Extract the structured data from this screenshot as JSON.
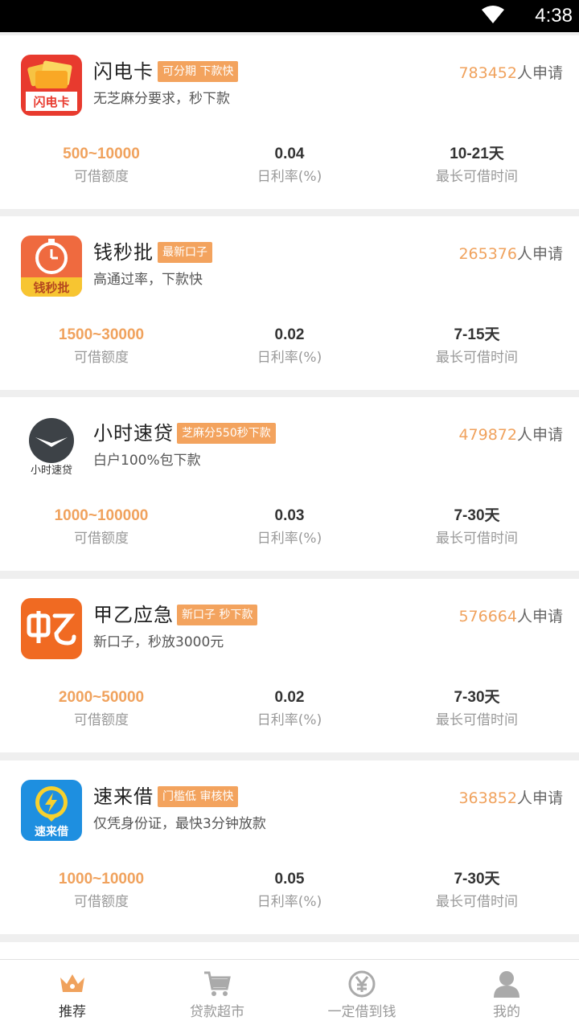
{
  "status_bar": {
    "time": "4:38"
  },
  "colors": {
    "accent": "#f0a25d",
    "tag_bg": "#f3a35e",
    "tab_active": "#f0a25d",
    "tab_inactive": "#aaaaaa"
  },
  "stat_labels": {
    "amount": "可借额度",
    "rate": "日利率(%)",
    "term": "最长可借时间"
  },
  "applicant_suffix": "人申请",
  "products": [
    {
      "name": "闪电卡",
      "tag": "可分期 下款快",
      "applicants": "783452",
      "desc": "无芝麻分要求，秒下款",
      "amount": "500~10000",
      "rate": "0.04",
      "term": "10-21天",
      "logo_text": "闪电卡",
      "icon": "credit-card-icon"
    },
    {
      "name": "钱秒批",
      "tag": "最新口子",
      "applicants": "265376",
      "desc": "高通过率，下款快",
      "amount": "1500~30000",
      "rate": "0.02",
      "term": "7-15天",
      "logo_text": "钱秒批",
      "icon": "stopwatch-icon"
    },
    {
      "name": "小时速贷",
      "tag": "芝麻分550秒下款",
      "applicants": "479872",
      "desc": "白户100%包下款",
      "amount": "1000~100000",
      "rate": "0.03",
      "term": "7-30天",
      "logo_text": "小时速贷",
      "icon": "clock-icon"
    },
    {
      "name": "甲乙应急",
      "tag": "新口子 秒下款",
      "applicants": "576664",
      "desc": "新口子，秒放3000元",
      "amount": "2000~50000",
      "rate": "0.02",
      "term": "7-30天",
      "logo_text": "甲乙",
      "icon": "jiayi-logo-icon"
    },
    {
      "name": "速来借",
      "tag": "门槛低 审核快",
      "applicants": "363852",
      "desc": "仅凭身份证，最快3分钟放款",
      "amount": "1000~10000",
      "rate": "0.05",
      "term": "7-30天",
      "logo_text": "速来借",
      "icon": "lightning-icon"
    }
  ],
  "tabs": [
    {
      "label": "推荐",
      "icon": "crown-icon",
      "active": true
    },
    {
      "label": "贷款超市",
      "icon": "cart-icon",
      "active": false
    },
    {
      "label": "一定借到钱",
      "icon": "yen-icon",
      "active": false
    },
    {
      "label": "我的",
      "icon": "person-icon",
      "active": false
    }
  ]
}
